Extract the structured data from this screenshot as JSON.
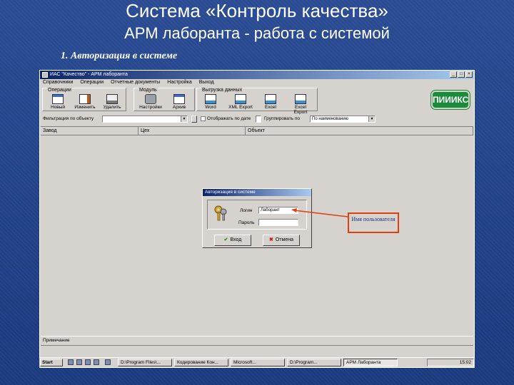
{
  "slide": {
    "title": "Система «Контроль качества»",
    "subtitle": "АРМ лаборанта - работа с системой",
    "step": "1. Авторизация в системе"
  },
  "window": {
    "title": "ИАС \"Качество\" - АРМ лаборанта",
    "menu": [
      "Справочники",
      "Операции",
      "Отчетные документы",
      "Настройка",
      "Выход"
    ]
  },
  "toolbar": {
    "groups": [
      {
        "label": "Операции",
        "buttons": [
          {
            "label": "Новый",
            "icon": "new-doc-icon"
          },
          {
            "label": "Изменить",
            "icon": "edit-icon"
          },
          {
            "label": "Удалить",
            "icon": "delete-icon"
          }
        ]
      },
      {
        "label": "Модуль",
        "buttons": [
          {
            "label": "Настройки",
            "icon": "tools-icon"
          },
          {
            "label": "Архив",
            "icon": "archive-icon"
          }
        ]
      },
      {
        "label": "Выгрузка данных",
        "buttons": [
          {
            "label": "Word",
            "icon": "word-icon"
          },
          {
            "label": "XML Export",
            "icon": "xml-export-icon"
          },
          {
            "label": "Excel",
            "icon": "excel-icon"
          },
          {
            "label": "Excel Export",
            "icon": "excel-export-icon"
          }
        ]
      }
    ],
    "logo": "ПИИИКС"
  },
  "filter": {
    "object_label": "Фильтрация по объекту",
    "show_label": "Отображать по дате",
    "sort_label": "Группировать по",
    "sort_value": "По наименованию"
  },
  "grid": {
    "columns": [
      "Завод",
      "Цех",
      "Объект"
    ]
  },
  "status": {
    "text": "Примечание"
  },
  "dialog": {
    "title": "Авторизация в системе",
    "login_label": "Логин",
    "login_value": "Лаборант",
    "password_label": "Пароль",
    "password_value": "",
    "ok_label": "Вход",
    "cancel_label": "Отмена"
  },
  "callout": {
    "text": "Имя пользователя"
  },
  "taskbar": {
    "start": "Start",
    "tasks": [
      {
        "label": "D:\\Program Files\\...",
        "active": false
      },
      {
        "label": "Кодирование Кон...",
        "active": false
      },
      {
        "label": "Microsoft...",
        "active": false
      },
      {
        "label": "D:\\Program...",
        "active": false
      },
      {
        "label": "АРМ Лаборанта",
        "active": true
      }
    ],
    "clock": "15:02"
  },
  "colors": {
    "slide_bg": "#1f3f86",
    "window_face": "#d6d3ce",
    "titlebar": "#0a246a",
    "callout_border": "#e04010",
    "logo_green": "#1b8a3a"
  }
}
